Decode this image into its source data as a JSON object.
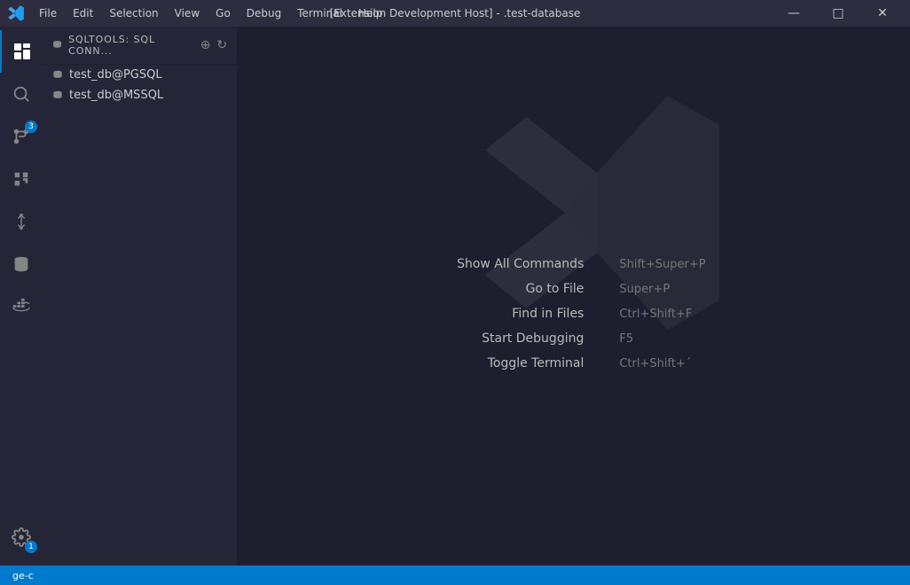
{
  "titlebar": {
    "title": "[Extension Development Host] - .test-database",
    "menu": [
      "File",
      "Edit",
      "Selection",
      "View",
      "Go",
      "Debug",
      "Terminal",
      "Help"
    ],
    "controls": {
      "minimize": "—",
      "maximize": "□",
      "close": "✕"
    }
  },
  "sidebar": {
    "header_label": "SQLTOOLS: SQL CONN...",
    "items": [
      {
        "label": "test_db@PGSQL"
      },
      {
        "label": "test_db@MSSQL"
      }
    ]
  },
  "shortcuts": [
    {
      "label": "Show All Commands",
      "key": "Shift+Super+P"
    },
    {
      "label": "Go to File",
      "key": "Super+P"
    },
    {
      "label": "Find in Files",
      "key": "Ctrl+Shift+F"
    },
    {
      "label": "Start Debugging",
      "key": "F5"
    },
    {
      "label": "Toggle Terminal",
      "key": "Ctrl+Shift+´"
    }
  ],
  "statusbar": {
    "item": "ge-c"
  },
  "icons": {
    "explorer": "⬜",
    "search": "🔍",
    "source_control": "⑂",
    "extensions": "⊞",
    "git": "↻",
    "docker": "🐳",
    "db_sidebar": "🗄",
    "db_activity": "🗃",
    "settings": "⚙",
    "minimize_char": "─",
    "maximize_char": "□",
    "close_char": "✕"
  },
  "colors": {
    "accent": "#007acc",
    "sidebar_bg": "#252538",
    "main_bg": "#1e1e2e",
    "titlebar_bg": "#2d2d3f"
  }
}
